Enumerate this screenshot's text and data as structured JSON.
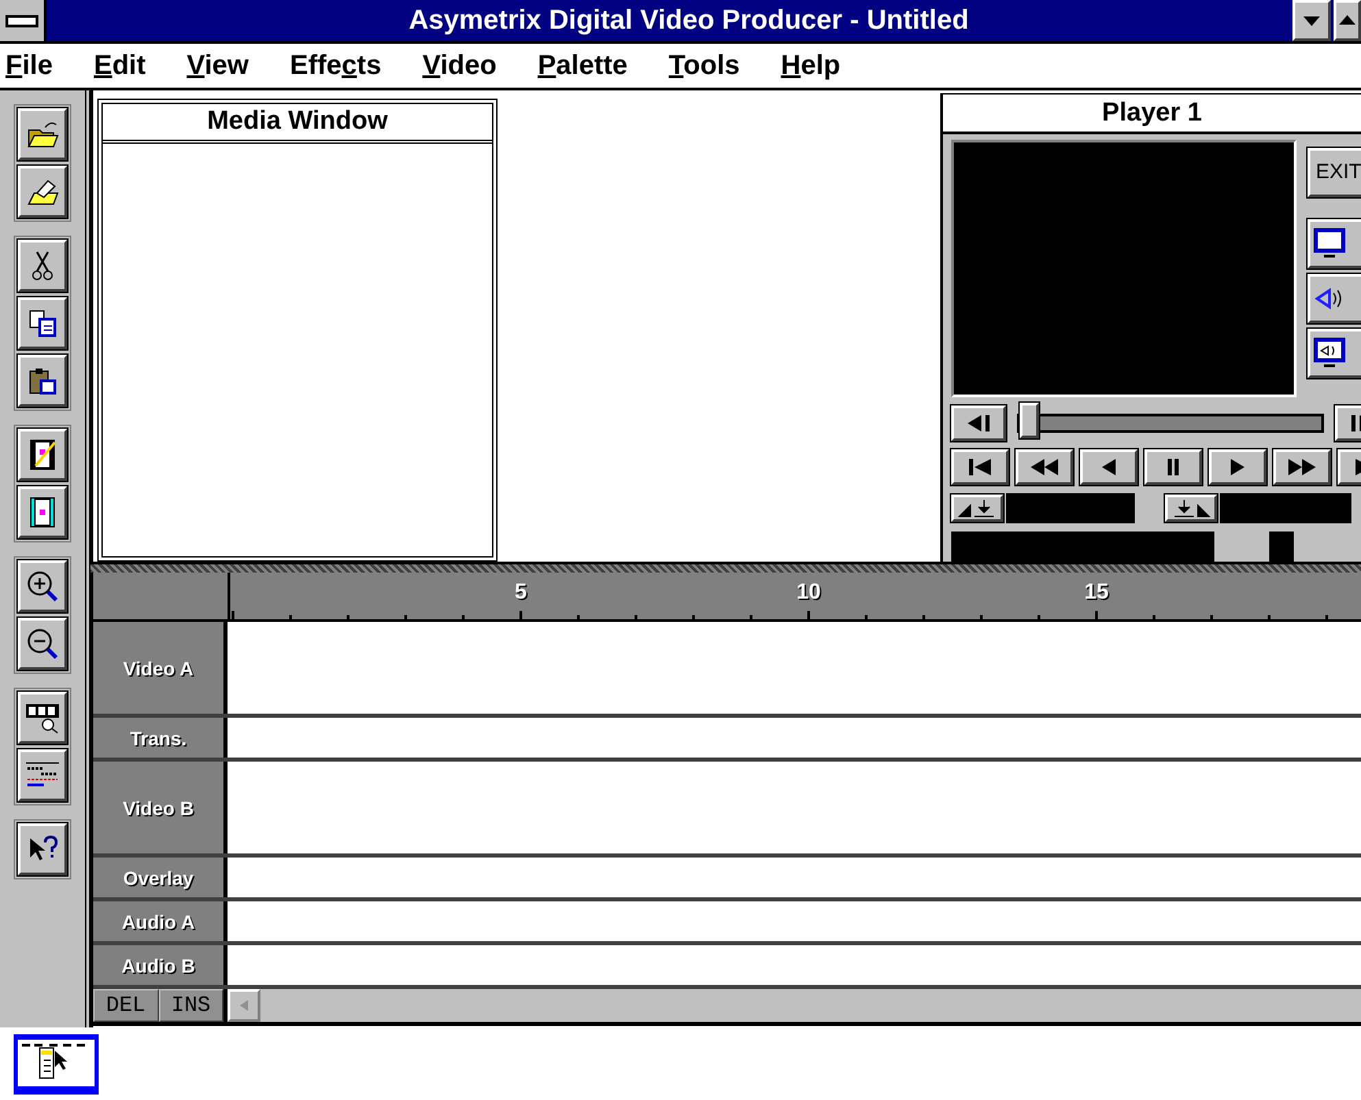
{
  "window": {
    "title": "Asymetrix Digital Video Producer - Untitled"
  },
  "menu": [
    {
      "key": "F",
      "after": "ile"
    },
    {
      "key": "E",
      "after": "dit"
    },
    {
      "key": "V",
      "after": "iew"
    },
    {
      "before": "Effe",
      "key": "c",
      "after": "ts"
    },
    {
      "key": "V",
      "after": "ideo"
    },
    {
      "key": "P",
      "after": "alette"
    },
    {
      "key": "T",
      "after": "ools"
    },
    {
      "key": "H",
      "after": "elp"
    }
  ],
  "media_window": {
    "title": "Media Window"
  },
  "player": {
    "title": "Player 1",
    "exit_label": "EXIT",
    "position": {
      "level": 0
    }
  },
  "timeline": {
    "ruler": [
      "5",
      "10",
      "15"
    ],
    "tracks": [
      {
        "name": "Video A",
        "kind": "tall"
      },
      {
        "name": "Trans.",
        "kind": "short"
      },
      {
        "name": "Video B",
        "kind": "tall"
      },
      {
        "name": "Overlay",
        "kind": "short"
      },
      {
        "name": "Audio A",
        "kind": "short"
      },
      {
        "name": "Audio B",
        "kind": "short"
      }
    ],
    "buttons": [
      "DEL",
      "INS"
    ]
  }
}
